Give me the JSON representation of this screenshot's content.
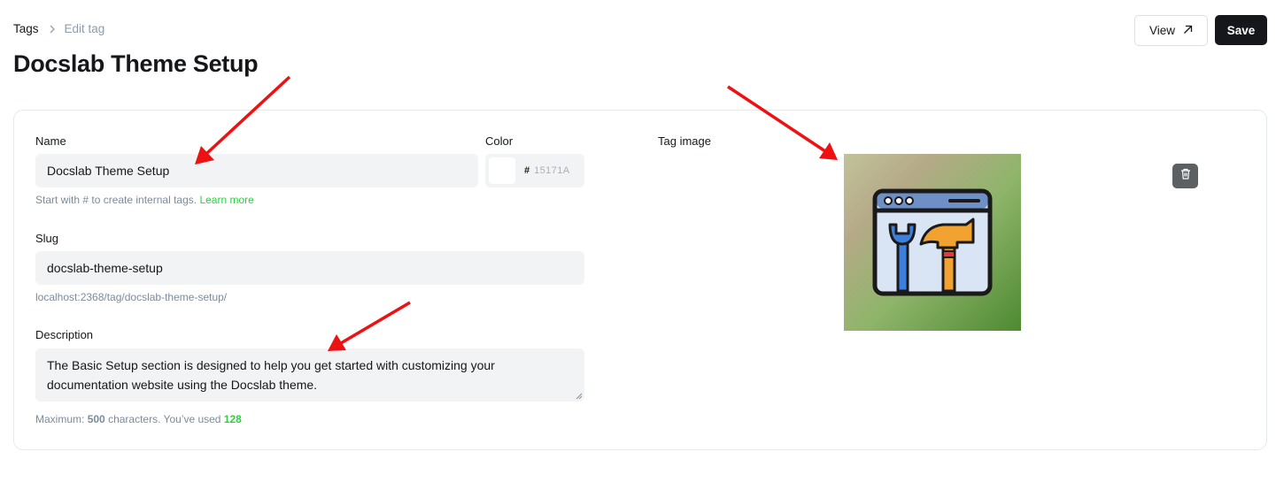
{
  "breadcrumb": {
    "parent": "Tags",
    "current": "Edit tag"
  },
  "page_title": "Docslab Theme Setup",
  "actions": {
    "view_label": "View",
    "save_label": "Save"
  },
  "form": {
    "name": {
      "label": "Name",
      "value": "Docslab Theme Setup",
      "hint_prefix": "Start with # to create internal tags.",
      "hint_link": "Learn more"
    },
    "color": {
      "label": "Color",
      "hash": "#",
      "placeholder": "15171A"
    },
    "slug": {
      "label": "Slug",
      "value": "docslab-theme-setup",
      "url_hint": "localhost:2368/tag/docslab-theme-setup/"
    },
    "description": {
      "label": "Description",
      "value": "The Basic Setup section is designed to help you get started with customizing your documentation website using the Docslab theme.",
      "hint_max_prefix": "Maximum:",
      "max_chars": "500",
      "hint_mid": "characters. You’ve used",
      "used_chars": "128"
    },
    "tag_image": {
      "label": "Tag image",
      "icon": "browser-wrench-hammer-icon"
    }
  },
  "colors": {
    "accent_green": "#30cf43",
    "primary_button": "#15171a",
    "annotation_arrow": "#ee1111"
  }
}
